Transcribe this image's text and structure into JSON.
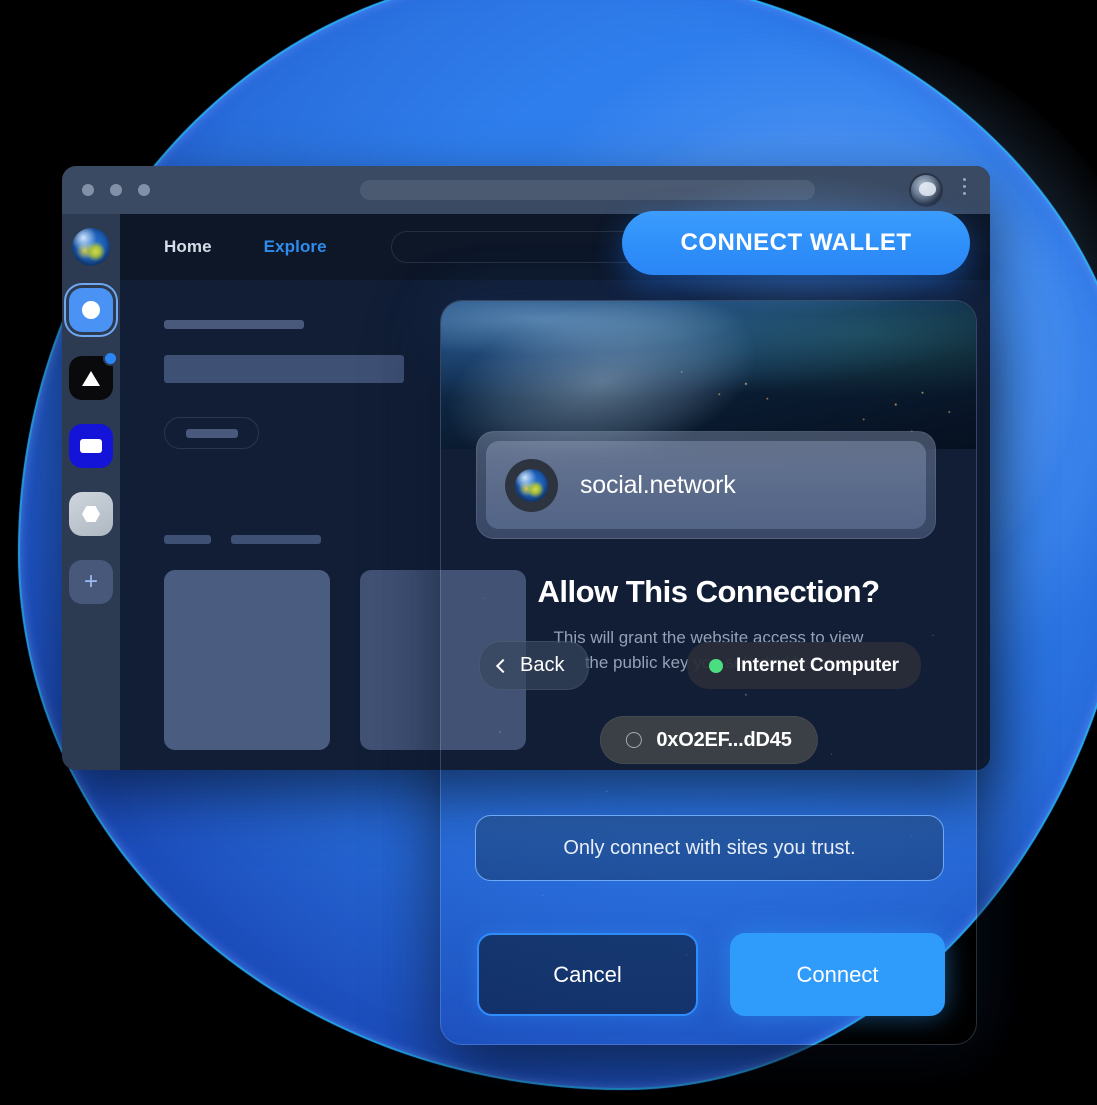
{
  "browser": {
    "window_controls": [
      "close",
      "minimize",
      "maximize"
    ],
    "url_value": "",
    "avatar_icon": "astronaut-avatar-icon",
    "menu_icon": "kebab-menu-icon"
  },
  "app": {
    "logo_icon": "globe-logo-icon",
    "sidebar": {
      "items": [
        {
          "name": "circle-app-icon",
          "glyph": "circle"
        },
        {
          "name": "triangle-app-icon",
          "glyph": "triangle",
          "badge": true
        },
        {
          "name": "card-app-icon",
          "glyph": "rectangle"
        },
        {
          "name": "hexagon-app-icon",
          "glyph": "hexagon"
        }
      ],
      "add_label": "+"
    },
    "nav": {
      "home_label": "Home",
      "explore_label": "Explore",
      "search_placeholder": ""
    },
    "cta": {
      "connect_wallet_label": "CONNECT WALLET"
    }
  },
  "modal": {
    "back_label": "Back",
    "back_icon": "chevron-left-icon",
    "network": {
      "label": "Internet Computer",
      "status_color": "#4ade80",
      "status_icon": "status-dot-icon"
    },
    "site": {
      "name": "social.network",
      "icon": "globe-site-icon"
    },
    "title": "Allow This Connection?",
    "subtitle": "This will grant the website access to view\nthe public key you selected here:",
    "address": {
      "value": "0xO2EF...dD45",
      "icon": "token-ring-icon"
    },
    "trust_notice": "Only connect with sites you trust.",
    "cancel_label": "Cancel",
    "connect_label": "Connect"
  },
  "colors": {
    "accent_blue": "#2f9bfb",
    "link_blue": "#2f8ced",
    "status_green": "#4ade80",
    "modal_bg": "#0a1426",
    "browser_bg": "#0f1b31"
  }
}
